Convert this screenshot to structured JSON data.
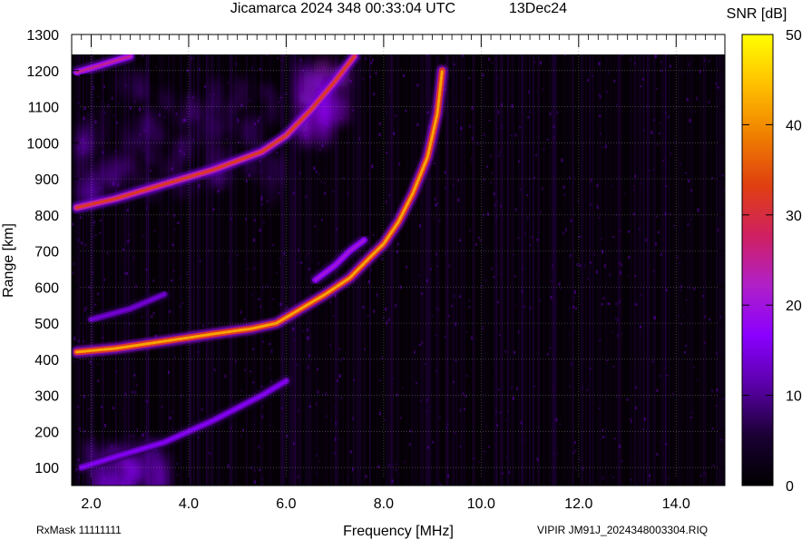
{
  "header": {
    "title": "Jicamarca 2024 348 00:33:04 UTC",
    "date": "13Dec24"
  },
  "footer": {
    "left": "RxMask 11111111",
    "right": "VIPIR  JM91J_2024348003304.RIQ"
  },
  "colorbar": {
    "label": "SNR [dB]",
    "ticks": [
      "50",
      "40",
      "30",
      "20",
      "10",
      "0"
    ],
    "range": [
      0,
      50
    ],
    "colors": [
      "#000000",
      "#1a0033",
      "#5a00a8",
      "#8a00ff",
      "#b020c8",
      "#d02060",
      "#e04010",
      "#f08000",
      "#ffc000",
      "#ffff00"
    ]
  },
  "chart_data": {
    "type": "heatmap",
    "title": "Jicamarca 2024 348 00:33:04 UTC",
    "xlabel": "Frequency [MHz]",
    "ylabel": "Range [km]",
    "xlim": [
      1.6,
      15.0
    ],
    "ylim": [
      50,
      1300
    ],
    "xticks": [
      "2.0",
      "4.0",
      "6.0",
      "8.0",
      "10.0",
      "12.0",
      "14.0"
    ],
    "yticks": [
      "100",
      "200",
      "300",
      "400",
      "500",
      "600",
      "700",
      "800",
      "900",
      "1000",
      "1100",
      "1200",
      "1300"
    ],
    "grid": true,
    "colorbar_label": "SNR [dB]",
    "traces": [
      {
        "points": [
          [
            1.7,
            420
          ],
          [
            2.5,
            430
          ],
          [
            3.5,
            450
          ],
          [
            4.5,
            470
          ],
          [
            5.3,
            485
          ],
          [
            5.8,
            500
          ],
          [
            6.3,
            540
          ],
          [
            6.8,
            580
          ],
          [
            7.3,
            625
          ],
          [
            7.7,
            680
          ],
          [
            8.0,
            720
          ],
          [
            8.3,
            780
          ],
          [
            8.6,
            860
          ],
          [
            8.9,
            960
          ],
          [
            9.1,
            1080
          ],
          [
            9.2,
            1200
          ]
        ],
        "snr": 42
      },
      {
        "points": [
          [
            1.7,
            820
          ],
          [
            2.5,
            845
          ],
          [
            3.5,
            885
          ],
          [
            4.5,
            925
          ],
          [
            5.5,
            975
          ],
          [
            6.0,
            1020
          ],
          [
            6.5,
            1090
          ],
          [
            7.0,
            1170
          ],
          [
            7.4,
            1240
          ]
        ],
        "snr": 32
      },
      {
        "points": [
          [
            1.7,
            1195
          ],
          [
            2.2,
            1215
          ],
          [
            2.8,
            1240
          ]
        ],
        "snr": 25
      },
      {
        "points": [
          [
            1.8,
            100
          ],
          [
            2.5,
            130
          ],
          [
            3.5,
            170
          ],
          [
            4.5,
            230
          ],
          [
            5.5,
            300
          ],
          [
            6.0,
            340
          ]
        ],
        "snr": 16
      },
      {
        "points": [
          [
            2.0,
            510
          ],
          [
            2.8,
            540
          ],
          [
            3.5,
            580
          ]
        ],
        "snr": 14
      },
      {
        "points": [
          [
            6.6,
            620
          ],
          [
            7.0,
            660
          ],
          [
            7.3,
            700
          ],
          [
            7.6,
            730
          ]
        ],
        "snr": 20
      }
    ],
    "diffuse_regions": [
      {
        "x": [
          1.7,
          5.8
        ],
        "y": [
          880,
          1200
        ],
        "snr": 14
      },
      {
        "x": [
          6.2,
          7.2
        ],
        "y": [
          1050,
          1240
        ],
        "snr": 18
      },
      {
        "x": [
          1.8,
          3.5
        ],
        "y": [
          60,
          180
        ],
        "snr": 15
      }
    ]
  }
}
